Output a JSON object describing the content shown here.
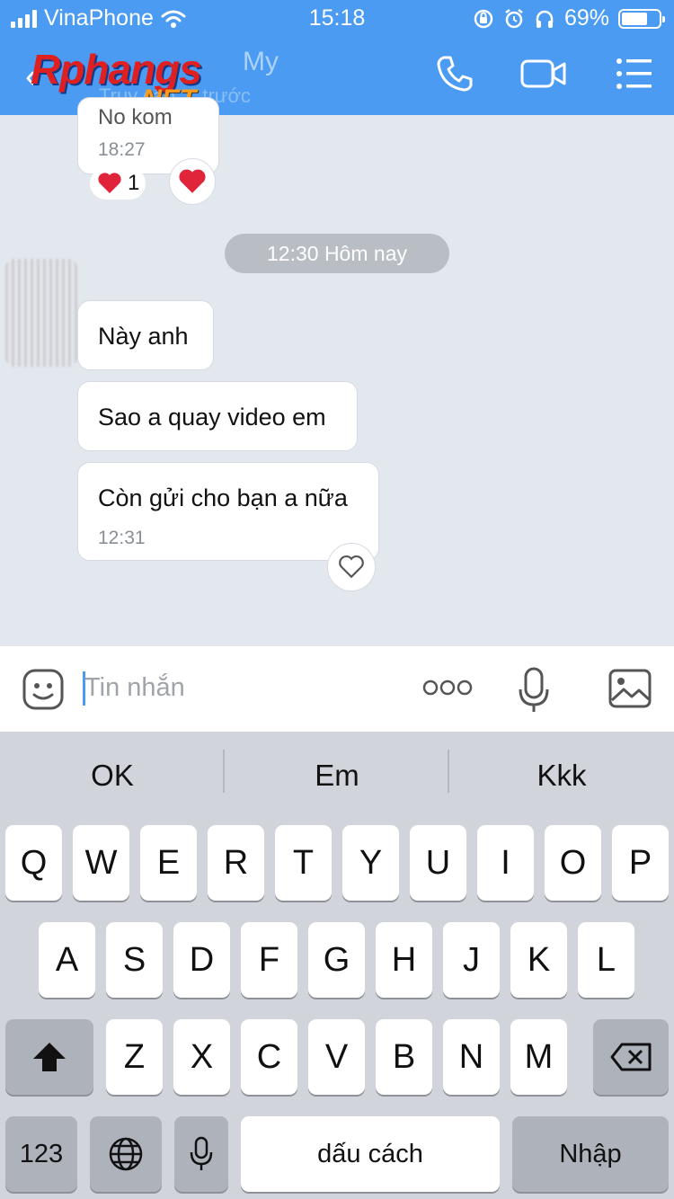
{
  "status_bar": {
    "carrier": "VinaPhone",
    "time": "15:18",
    "battery": "69%",
    "battery_level": 0.69
  },
  "header": {
    "contact_name": "My",
    "subtitle": "Truy cập ... trước",
    "watermark_main": "Rphangs",
    "watermark_sub": ".NET",
    "icons": [
      "back-icon",
      "phone-icon",
      "video-call-icon",
      "menu-list-icon"
    ]
  },
  "messages": {
    "earlier": {
      "partial_text": "No kom",
      "time": "18:27",
      "reaction_count": "1"
    },
    "date_divider": "12:30 Hôm nay",
    "incoming": [
      {
        "text": "Này anh"
      },
      {
        "text": "Sao a quay video em"
      },
      {
        "text": "Còn gửi cho bạn a nữa",
        "time": "12:31"
      }
    ]
  },
  "input": {
    "placeholder": "Tin nhắn",
    "icons": [
      "sticker-icon",
      "more-icon",
      "microphone-icon",
      "image-icon"
    ]
  },
  "keyboard": {
    "suggestions": [
      "OK",
      "Em",
      "Kkk"
    ],
    "row1": [
      "Q",
      "W",
      "E",
      "R",
      "T",
      "Y",
      "U",
      "I",
      "O",
      "P"
    ],
    "row2": [
      "A",
      "S",
      "D",
      "F",
      "G",
      "H",
      "J",
      "K",
      "L"
    ],
    "row3": [
      "Z",
      "X",
      "C",
      "V",
      "B",
      "N",
      "M"
    ],
    "numbers_key": "123",
    "space_key": "dấu cách",
    "return_key": "Nhập"
  },
  "colors": {
    "header": "#4a9bf1",
    "chat_bg": "#e3e7ee",
    "heart": "#e0253a",
    "keyboard_bg": "#d1d4da"
  }
}
